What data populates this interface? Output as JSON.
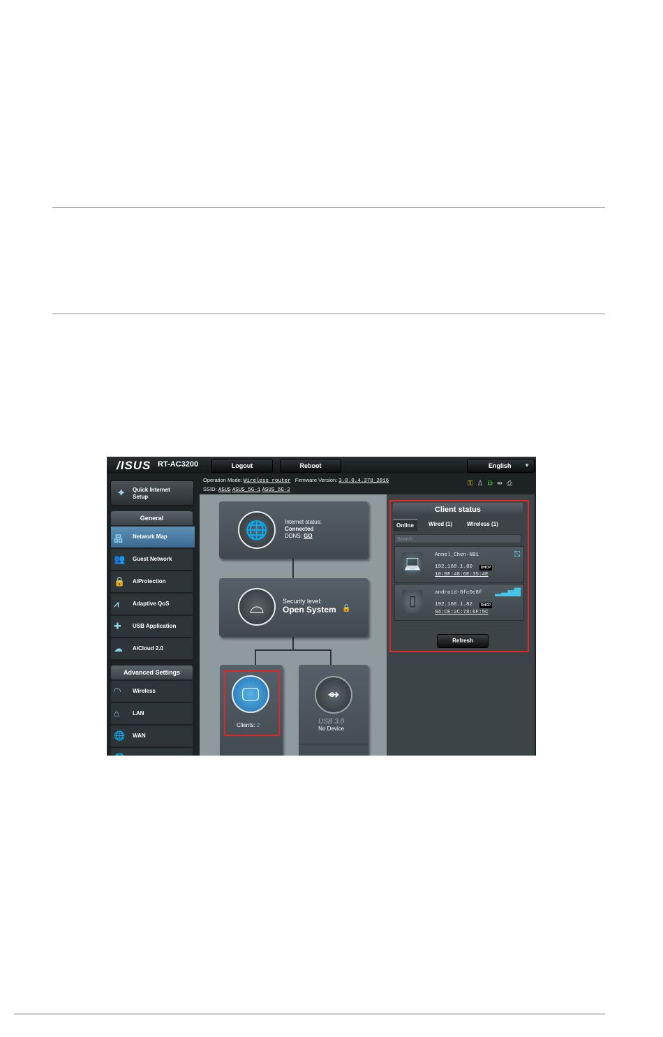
{
  "router": {
    "logo": "/ISUS",
    "model": "RT-AC3200",
    "logout_label": "Logout",
    "reboot_label": "Reboot",
    "language": "English",
    "operation_mode_label": "Operation Mode:",
    "operation_mode_value": "Wireless router",
    "firmware_label": "Firmware Version:",
    "firmware_value": "3.0.0.4.378_2816",
    "ssid_label": "SSID:",
    "ssids": [
      "ASUS",
      "ASUS_5G-1",
      "ASUS_5G-2"
    ],
    "quick_setup_line1": "Quick Internet",
    "quick_setup_line2": "Setup",
    "general_header": "General",
    "general_items": [
      {
        "label": "Network Map",
        "icon": "network-map-icon"
      },
      {
        "label": "Guest Network",
        "icon": "guest-network-icon"
      },
      {
        "label": "AiProtection",
        "icon": "lock-icon"
      },
      {
        "label": "Adaptive QoS",
        "icon": "qos-icon"
      },
      {
        "label": "USB Application",
        "icon": "puzzle-icon"
      },
      {
        "label": "AiCloud 2.0",
        "icon": "cloud-icon"
      }
    ],
    "advanced_header": "Advanced Settings",
    "advanced_items": [
      {
        "label": "Wireless",
        "icon": "wifi-icon"
      },
      {
        "label": "LAN",
        "icon": "home-icon"
      },
      {
        "label": "WAN",
        "icon": "globe-icon"
      }
    ],
    "internet_status_label": "Internet status:",
    "internet_status_value": "Connected",
    "ddns_label": "DDNS:",
    "ddns_value": "GO",
    "security_label": "Security level:",
    "security_value": "Open System",
    "clients_label": "Clients:",
    "clients_count": "2",
    "usb_label": "USB 3.0",
    "usb_status": "No Device",
    "client_status_title": "Client status",
    "tabs": [
      "Online",
      "Wired (1)",
      "Wireless (1)"
    ],
    "search_placeholder": "Search",
    "clients": [
      {
        "name": "Annel_Chen-NB1",
        "ip": "192.168.1.80",
        "badge": "DHCP",
        "mac": "10:BF:48:6E:35:4E"
      },
      {
        "name": "android-8fc0c8f",
        "ip": "192.168.1.82",
        "badge": "DHCP",
        "mac": "94:CE:2C:78:6F:5C"
      }
    ],
    "refresh_label": "Refresh"
  },
  "colors": {
    "highlight": "#e02727",
    "accent_blue": "#3a6a92"
  }
}
